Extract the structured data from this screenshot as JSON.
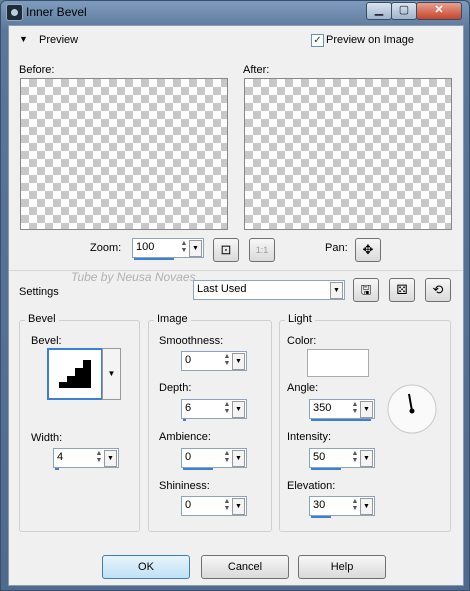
{
  "window": {
    "title": "Inner Bevel",
    "minimize_icon": "minimize-icon",
    "maximize_icon": "maximize-icon",
    "close_icon": "close-icon"
  },
  "preview": {
    "label": "Preview",
    "preview_on_image_label": "Preview on Image",
    "preview_on_image_checked": true,
    "before_label": "Before:",
    "after_label": "After:"
  },
  "zoom": {
    "label": "Zoom:",
    "value": "100",
    "actual_size_label": "1:1",
    "pan_label": "Pan:"
  },
  "settings": {
    "label": "Settings",
    "watermark": "Tube by Neusa Novaes",
    "preset": "Last Used"
  },
  "bevel": {
    "group_label": "Bevel",
    "bevel_label": "Bevel:",
    "width_label": "Width:",
    "width_value": "4"
  },
  "image": {
    "group_label": "Image",
    "smoothness_label": "Smoothness:",
    "smoothness_value": "0",
    "depth_label": "Depth:",
    "depth_value": "6",
    "ambience_label": "Ambience:",
    "ambience_value": "0",
    "shininess_label": "Shininess:",
    "shininess_value": "0"
  },
  "light": {
    "group_label": "Light",
    "color_label": "Color:",
    "color_value": "#ffffff",
    "angle_label": "Angle:",
    "angle_value": "350",
    "intensity_label": "Intensity:",
    "intensity_value": "50",
    "elevation_label": "Elevation:",
    "elevation_value": "30"
  },
  "buttons": {
    "ok": "OK",
    "cancel": "Cancel",
    "help": "Help"
  }
}
